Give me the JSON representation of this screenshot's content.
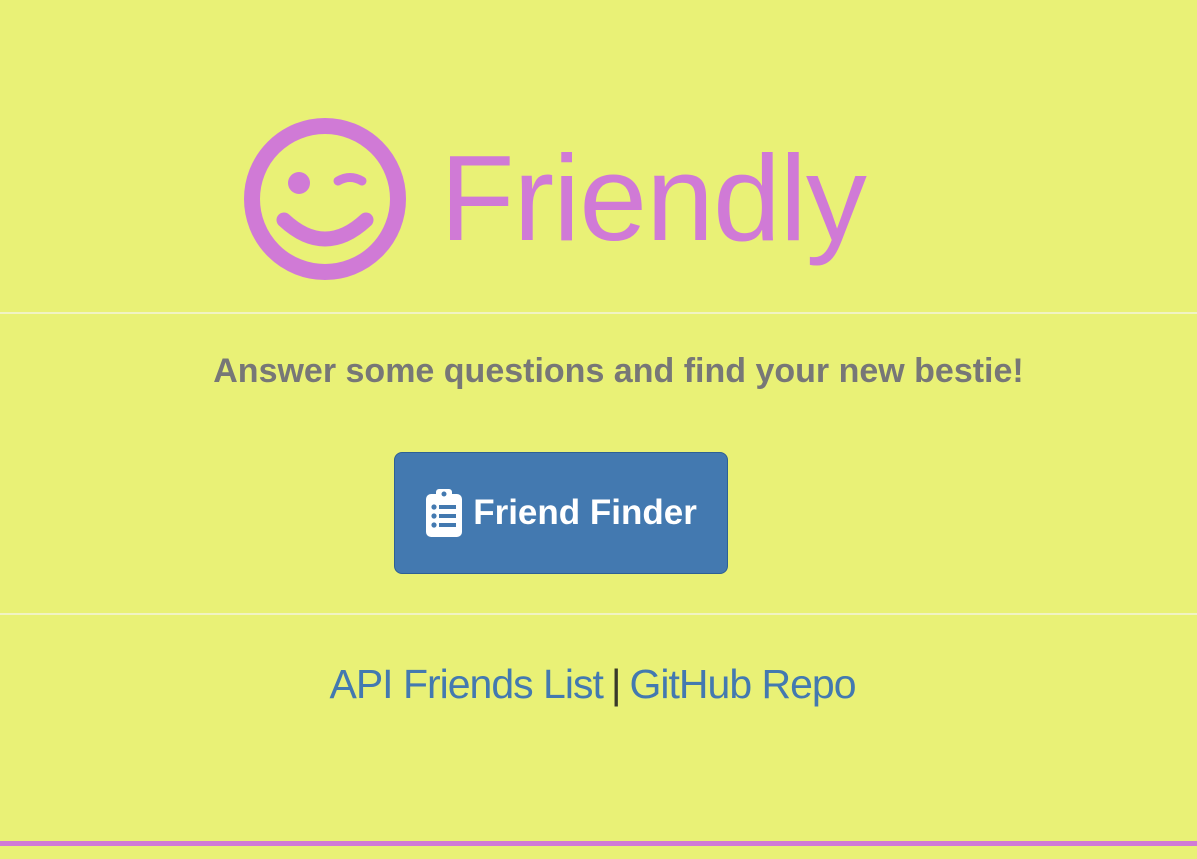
{
  "header": {
    "brand_name": "Friendly",
    "logo_icon": "winking-smiley-icon",
    "brand_color": "#d07ad6"
  },
  "main": {
    "tagline": "Answer some questions and find your new bestie!",
    "finder_button": {
      "label": "Friend Finder",
      "icon": "clipboard-list-icon",
      "color": "#4379b0"
    }
  },
  "footer": {
    "links": [
      {
        "label": "API Friends List"
      },
      {
        "label": "GitHub Repo"
      }
    ],
    "separator": "|"
  },
  "colors": {
    "background": "#e9f176",
    "link": "#4379b0",
    "tagline": "#777777",
    "accent_bar": "#d07ad6"
  }
}
